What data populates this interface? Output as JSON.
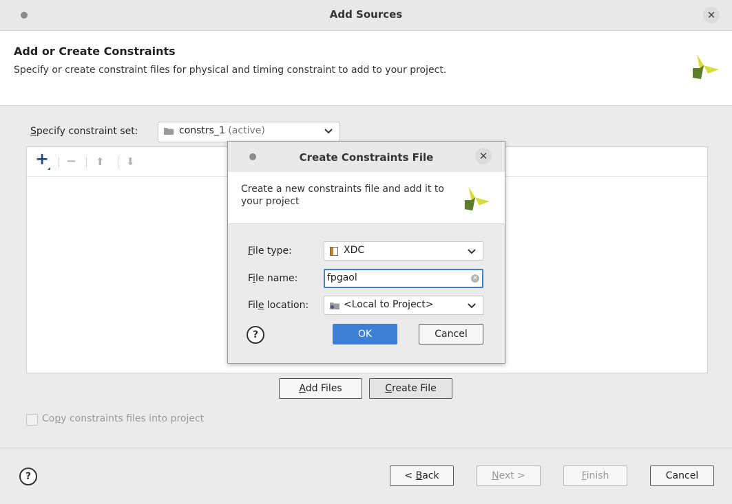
{
  "window": {
    "title": "Add Sources"
  },
  "header": {
    "title": "Add or Create Constraints",
    "description": "Specify or create constraint files for physical and timing constraint to add to your project."
  },
  "constraint_set": {
    "label_mnemonic": "S",
    "label_rest": "pecify constraint set:",
    "value": "constrs_1",
    "suffix": "(active)"
  },
  "toolbar": {
    "add": "+",
    "remove": "−",
    "up": "⬆",
    "down": "⬇"
  },
  "panel_buttons": {
    "add_files_mnemonic": "A",
    "add_files_rest": "dd Files",
    "create_file_mnemonic": "C",
    "create_file_rest": "reate File"
  },
  "copy_checkbox": {
    "pre": "Co",
    "mnemonic": "p",
    "post": "y constraints files into project",
    "checked": false
  },
  "footer": {
    "back_pre": "< ",
    "back_mnemonic": "B",
    "back_rest": "ack",
    "next_mnemonic": "N",
    "next_rest": "ext >",
    "finish_mnemonic": "F",
    "finish_rest": "inish",
    "cancel": "Cancel",
    "help": "?"
  },
  "dialog": {
    "title": "Create Constraints File",
    "description": "Create a new constraints file and add it to your project",
    "file_type": {
      "label_mnemonic": "F",
      "label_rest": "ile type:",
      "value": "XDC"
    },
    "file_name": {
      "label_pre": "F",
      "label_mnemonic": "i",
      "label_rest": "le name:",
      "value": "fpgaol"
    },
    "file_location": {
      "label_pre": "Fil",
      "label_mnemonic": "e",
      "label_rest": " location:",
      "value": "<Local to Project>"
    },
    "ok": "OK",
    "cancel": "Cancel",
    "help": "?"
  },
  "colors": {
    "accent": "#3c7fd6",
    "logo_yellow": "#d7dc3a",
    "logo_green": "#5d7d2b"
  }
}
